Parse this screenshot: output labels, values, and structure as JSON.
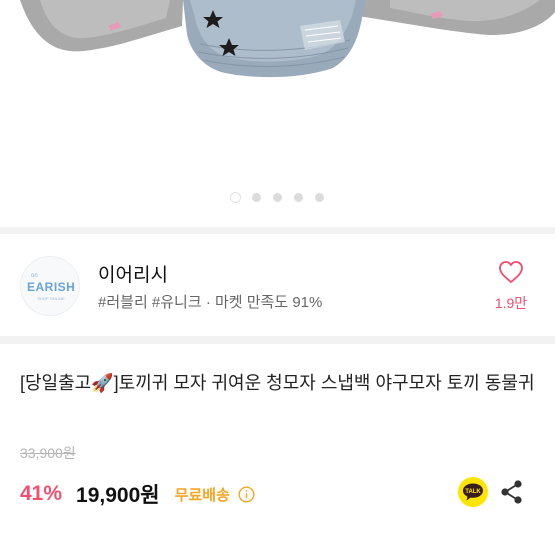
{
  "gallery": {
    "page_count": 5,
    "current_page": 1,
    "expand_icon": "expand-icon"
  },
  "seller": {
    "logo_small": "on",
    "logo_text": "EARISH",
    "logo_tagline": "SHOP ONLINE",
    "name": "이어리시",
    "tags": "#러블리 #유니크 · 마켓 만족도 91%",
    "like_count": "1.9만",
    "like_icon": "heart-icon"
  },
  "product": {
    "title": "[당일출고🚀]토끼귀 모자 귀여운 청모자 스냅백 야구모자 토끼 동물귀",
    "original_price": "33,900원",
    "discount": "41%",
    "price": "19,900원",
    "shipping": "무료배송",
    "talk_label": "TALK",
    "share_icon": "share-icon"
  },
  "colors": {
    "accent_pink": "#f04c6e",
    "shipping_orange": "#f5a623",
    "talk_yellow": "#fee500"
  }
}
